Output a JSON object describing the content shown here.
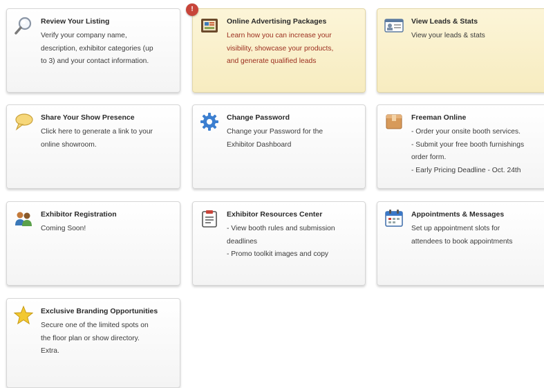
{
  "tiles": [
    {
      "id": "review-listing",
      "title": "Review Your Listing",
      "lines": [
        "Verify your company name,",
        "description, exhibitor categories (up",
        "to 3) and your contact information."
      ],
      "icon": "magnifier-icon"
    },
    {
      "id": "online-advertising",
      "title": "Online Advertising Packages",
      "lines": [
        "Learn how you can increase your",
        "visibility, showcase your products,",
        "and generate qualified leads"
      ],
      "icon": "advertising-board-icon",
      "badge": "!",
      "highlight_color": "#fcf5d8",
      "text_color": "#9b2d1e"
    },
    {
      "id": "leads-stats",
      "title": "View Leads & Stats",
      "lines": [
        "View your leads & stats"
      ],
      "icon": "id-card-icon",
      "highlight_color": "#fcf5d8"
    },
    {
      "id": "share-presence",
      "title": "Share Your Show Presence",
      "lines": [
        "Click here to generate a link to your",
        "online showroom."
      ],
      "icon": "speech-bubble-icon"
    },
    {
      "id": "change-password",
      "title": "Change Password",
      "lines": [
        "Change your Password for the",
        "Exhibitor Dashboard"
      ],
      "icon": "gear-icon"
    },
    {
      "id": "freeman-online",
      "title": "Freeman Online",
      "lines": [
        "- Order your onsite booth services.",
        "- Submit your free booth furnishings",
        "order form.",
        "- Early Pricing Deadline - Oct. 24th"
      ],
      "icon": "box-icon"
    },
    {
      "id": "exhibitor-registration",
      "title": "Exhibitor Registration",
      "lines": [
        "Coming Soon!"
      ],
      "icon": "people-icon"
    },
    {
      "id": "resources-center",
      "title": "Exhibitor Resources Center",
      "lines": [
        "- View booth rules and submission",
        "deadlines",
        "- Promo toolkit images and copy"
      ],
      "icon": "clipboard-icon"
    },
    {
      "id": "appointments",
      "title": "Appointments & Messages",
      "lines": [
        "Set up appointment slots for",
        "attendees to book appointments"
      ],
      "icon": "calendar-icon"
    },
    {
      "id": "branding",
      "title": "Exclusive Branding Opportunities",
      "lines": [
        "Secure one of the limited spots on",
        "the floor plan or show directory.",
        "Extra."
      ],
      "icon": "star-icon"
    }
  ]
}
